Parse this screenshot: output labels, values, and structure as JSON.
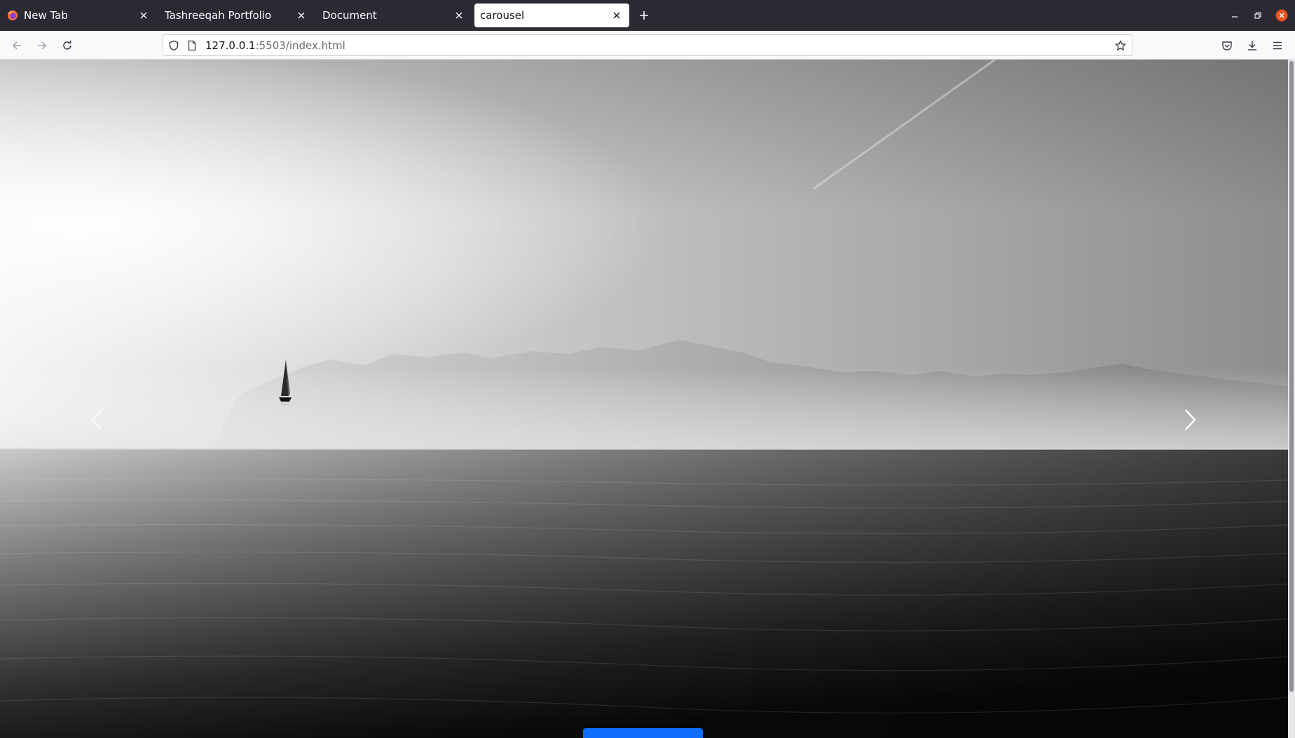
{
  "browser": {
    "tabs": [
      {
        "title": "New Tab",
        "active": false,
        "favicon": "firefox-icon"
      },
      {
        "title": "Tashreeqah Portfolio",
        "active": false
      },
      {
        "title": "Document",
        "active": false
      },
      {
        "title": "carousel",
        "active": true
      }
    ],
    "url": {
      "host": "127.0.0.1",
      "rest": ":5503/index.html"
    },
    "icons": {
      "back": "arrow-left-icon",
      "forward": "arrow-right-icon",
      "reload": "reload-icon",
      "tracking": "shield-icon",
      "page": "page-icon",
      "bookmark": "star-icon",
      "pocket": "pocket-icon",
      "downloads": "download-icon",
      "menu": "hamburger-menu-icon",
      "minimize": "minimize-icon",
      "restore": "restore-icon",
      "close": "close-window-icon"
    },
    "colors": {
      "tabstrip": "#2b2a33",
      "navbar": "#f9f9fb",
      "close_window": "#e95420"
    }
  },
  "page": {
    "carousel": {
      "image": "black and white photo of a sailboat on a calm sea below a misty mountain range",
      "prev_icon": "chevron-left-icon",
      "next_icon": "chevron-right-icon"
    },
    "cta_button": {
      "color": "#0d6efd"
    }
  }
}
